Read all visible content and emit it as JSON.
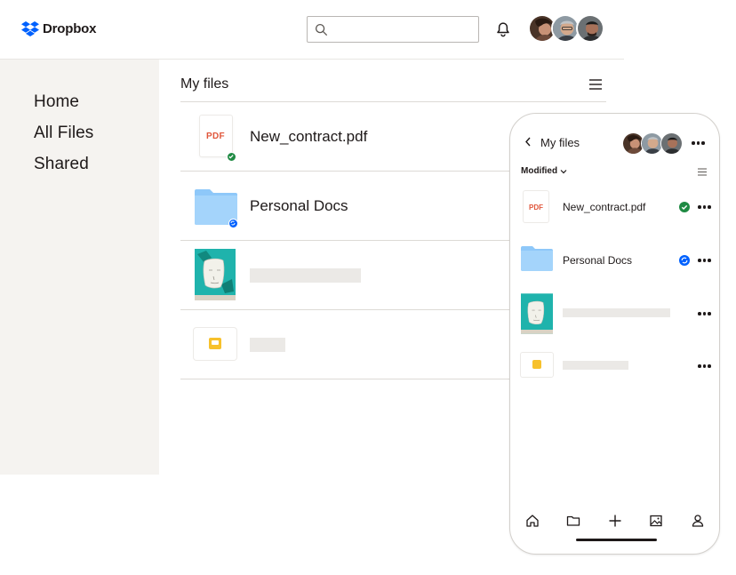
{
  "app": {
    "brand": "Dropbox",
    "accent": "#0061fe"
  },
  "header": {
    "search_placeholder": "",
    "icons": [
      "search-icon",
      "bell-icon"
    ],
    "avatar_count": 3
  },
  "sidebar": {
    "items": [
      {
        "label": "Home"
      },
      {
        "label": "All Files"
      },
      {
        "label": "Shared"
      }
    ]
  },
  "main": {
    "title": "My files",
    "files": [
      {
        "name": "New_contract.pdf",
        "type": "pdf",
        "thumb_label": "PDF",
        "status": "synced"
      },
      {
        "name": "Personal Docs",
        "type": "folder",
        "status": "syncing"
      },
      {
        "name": "",
        "type": "image",
        "status": ""
      },
      {
        "name": "",
        "type": "slides",
        "status": ""
      }
    ]
  },
  "phone": {
    "title": "My files",
    "sort_label": "Modified",
    "files": [
      {
        "name": "New_contract.pdf",
        "type": "pdf",
        "thumb_label": "PDF",
        "status": "synced"
      },
      {
        "name": "Personal Docs",
        "type": "folder",
        "status": "syncing"
      },
      {
        "name": "",
        "type": "image",
        "status": ""
      },
      {
        "name": "",
        "type": "slides",
        "status": ""
      }
    ],
    "bottom_nav": [
      "home-icon",
      "folder-icon",
      "plus-icon",
      "photos-icon",
      "account-icon"
    ]
  },
  "colors": {
    "synced": "#1f8a43",
    "syncing": "#0061fe",
    "folder": "#8ec8f9",
    "sidebar_bg": "#f5f3f0",
    "pdf_label": "#e0563b",
    "slides": "#f7c12c"
  }
}
